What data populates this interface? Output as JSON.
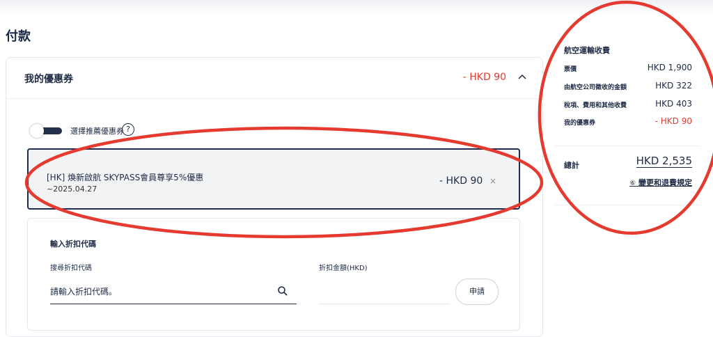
{
  "page": {
    "title": "付款"
  },
  "coupon": {
    "header_title": "我的優惠券",
    "header_amount": "- HKD 90",
    "toggle_label": "選擇推薦優惠券",
    "help_glyph": "?",
    "selected": {
      "name": "[HK] 煥新啟航 SKYPASS會員尊享5%優惠",
      "date": "~2025.04.27",
      "amount": "- HKD 90",
      "remove_glyph": "×"
    },
    "code_panel": {
      "title": "輸入折扣代碼",
      "search_label": "搜尋折扣代碼",
      "search_placeholder": "請輸入折扣代碼。",
      "discount_label": "折扣金額(HKD)",
      "discount_value": "",
      "apply_label": "申請"
    }
  },
  "summary": {
    "title": "航空運輸收費",
    "rows": [
      {
        "label": "票價",
        "value": "HKD 1,900"
      },
      {
        "label": "由航空公司徵收的金額",
        "value": "HKD 322"
      },
      {
        "label": "稅項、費用和其他收費",
        "value": "HKD 403"
      },
      {
        "label": "我的優惠券",
        "value": "- HKD 90"
      }
    ],
    "total_label": "總計",
    "total_value": "HKD 2,535",
    "refund_icon": "⑥",
    "refund_link": "變更和退費規定"
  },
  "colors": {
    "accent_red": "#e23b2f",
    "navy": "#1f2b55",
    "annotation": "#e53a2f"
  }
}
